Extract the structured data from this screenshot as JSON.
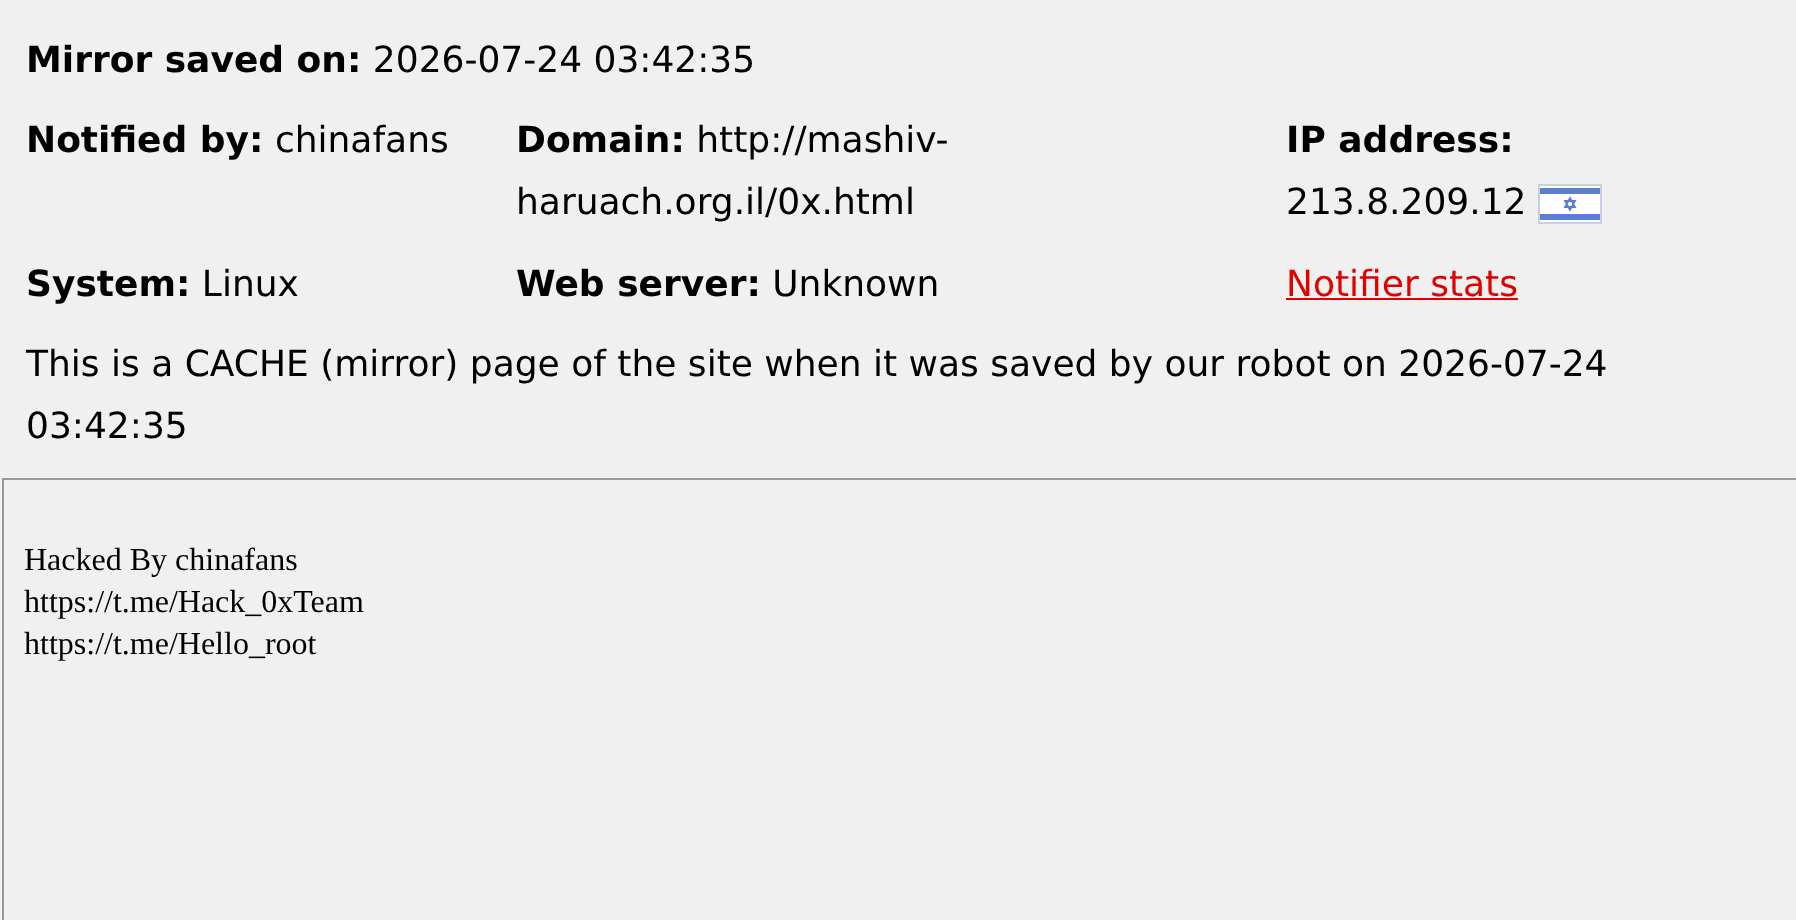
{
  "mirror_saved": "**Mirror saved on:** 2026-07-24 03:42:35",
  "details": [
    {
      "kind": "text",
      "text": "**Notified by:** chinafans"
    },
    {
      "kind": "text",
      "text": "**Domain:** http://mashiv-haruach.org.il/0x.html"
    },
    {
      "kind": "ip",
      "label": "IP address:",
      "value": "213.8.209.12"
    },
    {
      "kind": "text",
      "text": "**System:** Linux"
    },
    {
      "kind": "text",
      "text": "**Web server:** Unknown"
    },
    {
      "kind": "link",
      "text": "Notifier stats"
    }
  ],
  "notice": "This is a CACHE (mirror) page of the site when it was saved by our robot on 2026-07-24 03:42:35",
  "frame": {
    "lines": [
      "Hacked By chinafans",
      "https://t.me/Hack_0xTeam",
      "https://t.me/Hello_root"
    ]
  }
}
